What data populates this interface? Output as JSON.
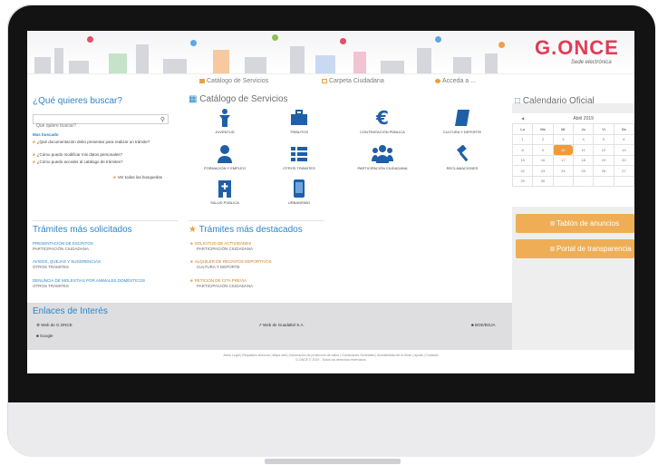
{
  "logo": {
    "brand": "G.ONCE",
    "subtitle": "Sede electrónica"
  },
  "topnav": [
    {
      "label": "Catálogo de Servicios",
      "color": "#e8a33d"
    },
    {
      "label": "Carpeta Ciudadana",
      "color": "#e8a33d"
    },
    {
      "label": "Acceda a ...",
      "color": "#e8a33d"
    }
  ],
  "search_panel": {
    "title": "¿Qué quieres buscar?",
    "placeholder": "Que quiere buscar?",
    "faq_title": "Mas buscado",
    "faqs": [
      "¿Qué documentación debo presentar para realizar un trámite?",
      "¿Cómo puedo modificar mis datos personales?",
      "¿Cómo puedo acceder al catálogo de trámites?"
    ],
    "all_link": "Ver todas las busquedas"
  },
  "catalog": {
    "title": "Catálogo de Servicios",
    "items": [
      {
        "label": "JUVENTUD",
        "icon": "person-icon"
      },
      {
        "label": "TRIBUTOS",
        "icon": "briefcase-icon"
      },
      {
        "label": "CONTRATACIÓN PÚBLICA",
        "icon": "euro-icon"
      },
      {
        "label": "CULTURA Y DEPORTE",
        "icon": "book-icon"
      },
      {
        "label": "FORMACIÓN Y EMPLEO",
        "icon": "user-icon"
      },
      {
        "label": "OTROS TRÁMITES",
        "icon": "list-icon"
      },
      {
        "label": "PARTICIPACIÓN CIUDADANA",
        "icon": "group-icon"
      },
      {
        "label": "RECLAMACIONES",
        "icon": "gavel-icon"
      },
      {
        "label": "SALUD PÚBLICA",
        "icon": "hospital-icon"
      },
      {
        "label": "URBANISMO",
        "icon": "mobile-icon"
      }
    ]
  },
  "calendar": {
    "title": "Calendario Oficial",
    "month": "Abril 2019",
    "weekdays": [
      "Lu",
      "Ma",
      "Mi",
      "Ju",
      "Vi",
      "Sa"
    ],
    "weeks": [
      [
        "1",
        "2",
        "3",
        "4",
        "5",
        "6"
      ],
      [
        "8",
        "9",
        "10",
        "11",
        "12",
        "13"
      ],
      [
        "15",
        "16",
        "17",
        "18",
        "19",
        "20"
      ],
      [
        "22",
        "23",
        "24",
        "25",
        "26",
        "27"
      ],
      [
        "29",
        "30",
        "",
        "",
        "",
        ""
      ]
    ],
    "today": "10",
    "accent": "#ef9b3a"
  },
  "buttons": {
    "tablon": "Tablón de anuncios",
    "portal": "Portal de transparencia"
  },
  "solicitados": {
    "title": "Trámites más solicitados",
    "items": [
      {
        "title": "PRESENTACIÓN DE ESCRITOS",
        "sub": "PARTICIPACIÓN CIUDADANA"
      },
      {
        "title": "AVISOS, QUEJAS Y SUGERENCIAS",
        "sub": "OTROS TRÁMITES"
      },
      {
        "title": "DENUNCIA DE MOLESTIAS POR ANIMALES DOMÉSTICOS",
        "sub": "OTROS TRÁMITES"
      }
    ]
  },
  "destacados": {
    "title": "Trámites más destacados",
    "items": [
      {
        "title": "SOLICITUD DE ACTIVIDADES",
        "sub": "PARTICIPACIÓN CIUDADANA"
      },
      {
        "title": "ALQUILER DE RECINTOS DEPORTIVOS",
        "sub": "CULTURA Y DEPORTE"
      },
      {
        "title": "PETICIÓN DE CITA PREVIA",
        "sub": "PARTICIPACIÓN CIUDADANA"
      }
    ]
  },
  "enlaces": {
    "title": "Enlaces de Interés",
    "links": [
      "Web de G.ONCE",
      "Web de Guadaltel S.A.",
      "BOE/BOJA",
      "Google"
    ]
  },
  "footer": {
    "line1": "Aviso Legal | Requisitos técnicos | Mapa web | Información de protección de datos | Condiciones Generales | Accesibilidad de la Sede | Ayuda | Contacto",
    "line2": "G.ONCE © 2019 - Todos los derechos reservados"
  }
}
